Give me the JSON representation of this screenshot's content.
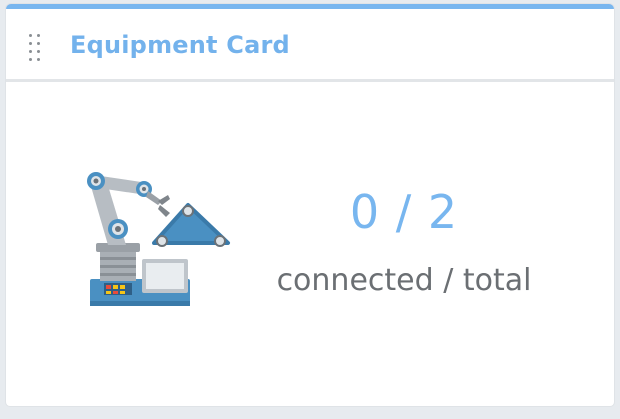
{
  "card": {
    "title": "Equipment Card",
    "drag_icon": "drag-handle-icon",
    "illustration_icon": "robot-arm-icon",
    "stats": {
      "connected": 0,
      "total": 2,
      "count_text": "0 / 2",
      "caption": "connected / total"
    }
  },
  "colors": {
    "accent": "#78b6ef",
    "caption": "#6b6f73",
    "divider": "#e2e5e8"
  }
}
